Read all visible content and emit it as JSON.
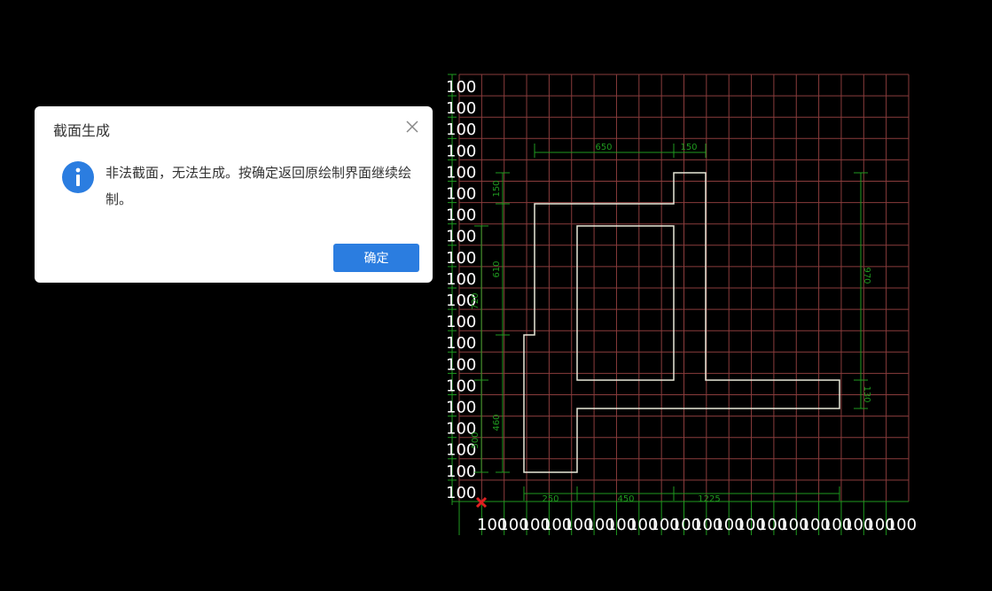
{
  "dialog": {
    "title": "截面生成",
    "message": "非法截面，无法生成。按确定返回原绘制界面继续绘制。",
    "ok_label": "确定"
  },
  "grid": {
    "row_labels": [
      "100",
      "100",
      "100",
      "100",
      "100",
      "100",
      "100",
      "100",
      "100",
      "100",
      "100",
      "100",
      "100",
      "100",
      "100",
      "100",
      "100",
      "100",
      "100",
      "100"
    ],
    "col_labels": [
      "100",
      "100",
      "100",
      "100",
      "100",
      "100",
      "100",
      "100",
      "100",
      "100",
      "100",
      "100",
      "100",
      "100",
      "100",
      "100",
      "100",
      "100",
      "100",
      "100"
    ]
  },
  "dimensions": {
    "top": [
      "650",
      "150"
    ],
    "bottom": [
      "250",
      "450",
      "1225"
    ],
    "left_outer": [
      "150",
      "610",
      "460"
    ],
    "left_inner": [
      "720",
      "500"
    ],
    "right": [
      "970",
      "130"
    ]
  },
  "colors": {
    "grid_line": "#8a3c3c",
    "dimension": "#1f9a1f",
    "outline": "#e8e8d8",
    "label": "#ffffff",
    "origin_marker": "#e02020",
    "accent": "#2b7de0"
  }
}
